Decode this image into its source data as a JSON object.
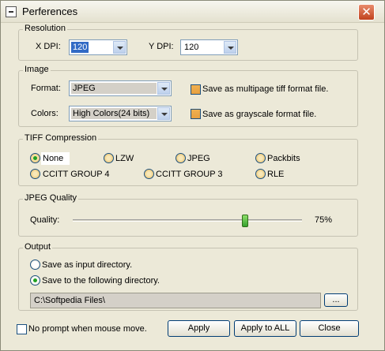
{
  "window": {
    "title": "Perferences",
    "close_glyph": "✕"
  },
  "resolution": {
    "group_label": "Resolution",
    "x_label": "X DPI:",
    "x_value": "120",
    "y_label": "Y DPI:",
    "y_value": "120"
  },
  "image": {
    "group_label": "Image",
    "format_label": "Format:",
    "format_value": "JPEG",
    "colors_label": "Colors:",
    "colors_value": "High Colors(24 bits)",
    "multipage_label": "Save as multipage tiff format file.",
    "grayscale_label": "Save as grayscale format file."
  },
  "tiff": {
    "group_label": "TIFF Compression",
    "selected": "None",
    "options": [
      "None",
      "LZW",
      "JPEG",
      "Packbits",
      "CCITT GROUP 4",
      "CCITT GROUP 3",
      "RLE"
    ]
  },
  "jpeg_quality": {
    "group_label": "JPEG Quality",
    "quality_label": "Quality:",
    "value_text": "75%",
    "value_fraction": 0.75
  },
  "output": {
    "group_label": "Output",
    "option_input_dir": "Save as input directory.",
    "option_following_dir": "Save to the following directory.",
    "selected": "following",
    "directory": "C:\\Softpedia Files\\",
    "browse_label": "..."
  },
  "footer": {
    "no_prompt_label": "No prompt when mouse move.",
    "apply_label": "Apply",
    "apply_all_label": "Apply to ALL",
    "close_label": "Close"
  }
}
